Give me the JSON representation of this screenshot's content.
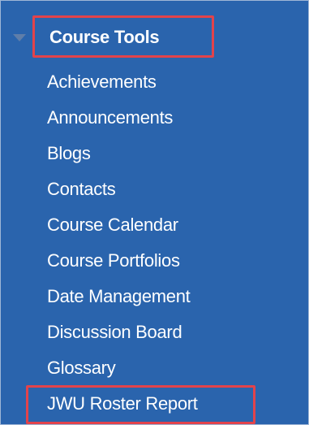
{
  "menu": {
    "title": "Course Tools",
    "items": [
      {
        "label": "Achievements"
      },
      {
        "label": "Announcements"
      },
      {
        "label": "Blogs"
      },
      {
        "label": "Contacts"
      },
      {
        "label": "Course Calendar"
      },
      {
        "label": "Course Portfolios"
      },
      {
        "label": "Date Management"
      },
      {
        "label": "Discussion Board"
      },
      {
        "label": "Glossary"
      },
      {
        "label": "JWU Roster Report"
      }
    ]
  },
  "colors": {
    "panel_background": "#2a64ad",
    "text": "#ffffff",
    "highlight_border": "#e2434b",
    "caret": "#5f7ea9"
  },
  "icons": {
    "expand_caret": "caret-down-icon"
  }
}
